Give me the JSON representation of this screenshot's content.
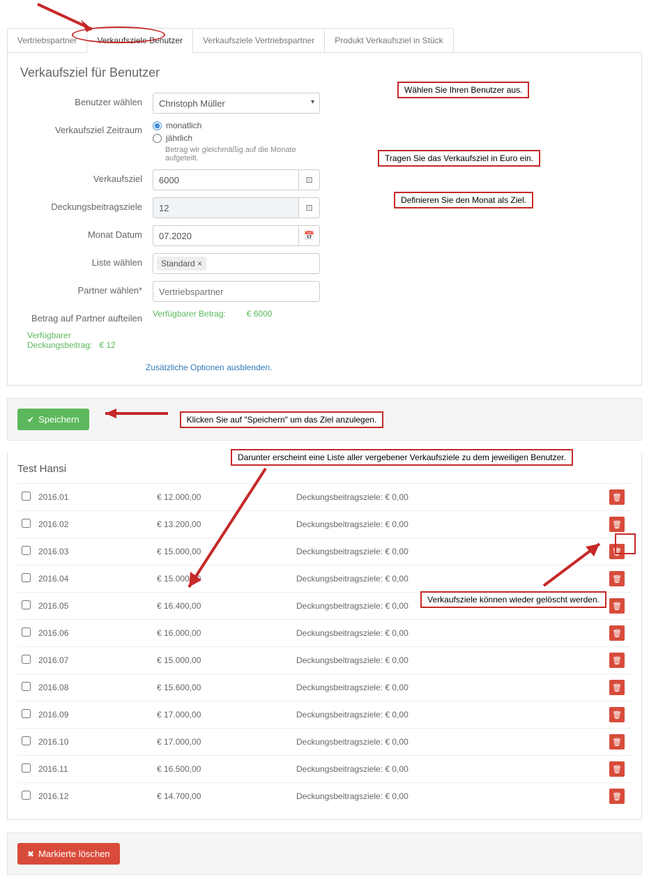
{
  "tabs": [
    "Vertriebspartner",
    "Verkaufsziele Benutzer",
    "Verkaufsziele Vertriebspartner",
    "Produkt Verkaufsziel in Stück"
  ],
  "panel_title": "Verkaufsziel für Benutzer",
  "labels": {
    "user": "Benutzer wählen",
    "period": "Verkaufsziel Zeitraum",
    "target": "Verkaufsziel",
    "margin": "Deckungsbeitragsziele",
    "month": "Monat Datum",
    "list": "Liste wählen",
    "partner": "Partner wählen*",
    "split": "Betrag auf Partner aufteilen"
  },
  "form": {
    "user_value": "Christoph Müller",
    "radio_monthly": "monatlich",
    "radio_yearly": "jährlich",
    "yearly_hint": "Betrag wir gleichmäßig auf die Monate aufgeteilt.",
    "target_value": "6000",
    "margin_value": "12",
    "month_value": "07.2020",
    "list_tag": "Standard ×",
    "partner_placeholder": "Vertriebspartner",
    "avail_label": "Verfügbarer Betrag:",
    "avail_value": "€ 6000",
    "avail_margin_label": "Verfügbarer Deckungsbeitrag:",
    "avail_margin_value": "€ 12",
    "hide_options": "Zusätzliche Optionen ausblenden."
  },
  "buttons": {
    "save": "Speichern",
    "delete_marked": "Markierte löschen"
  },
  "list_title": "Test Hansi",
  "margin_prefix": "Deckungsbeitragsziele: € 0,00",
  "rows": [
    {
      "date": "2016.01",
      "amount": "€ 12.000,00"
    },
    {
      "date": "2016.02",
      "amount": "€ 13.200,00"
    },
    {
      "date": "2016.03",
      "amount": "€ 15.000,00"
    },
    {
      "date": "2016.04",
      "amount": "€ 15.000,00"
    },
    {
      "date": "2016.05",
      "amount": "€ 16.400,00"
    },
    {
      "date": "2016.06",
      "amount": "€ 16.000,00"
    },
    {
      "date": "2016.07",
      "amount": "€ 15.000,00"
    },
    {
      "date": "2016.08",
      "amount": "€ 15.600,00"
    },
    {
      "date": "2016.09",
      "amount": "€ 17.000,00"
    },
    {
      "date": "2016.10",
      "amount": "€ 17.000,00"
    },
    {
      "date": "2016.11",
      "amount": "€ 16.500,00"
    },
    {
      "date": "2016.12",
      "amount": "€ 14.700,00"
    }
  ],
  "annotations": {
    "a1": "Wählen Sie Ihren Benutzer aus.",
    "a2": "Tragen Sie das Verkaufsziel in Euro ein.",
    "a3": "Definieren Sie den Monat als Ziel.",
    "a4": "Klicken Sie auf \"Speichern\" um das Ziel anzulegen.",
    "a5": "Darunter erscheint eine Liste aller vergebener Verkaufsziele zu dem jeweiligen Benutzer.",
    "a6": "Verkaufsziele können wieder gelöscht werden."
  }
}
